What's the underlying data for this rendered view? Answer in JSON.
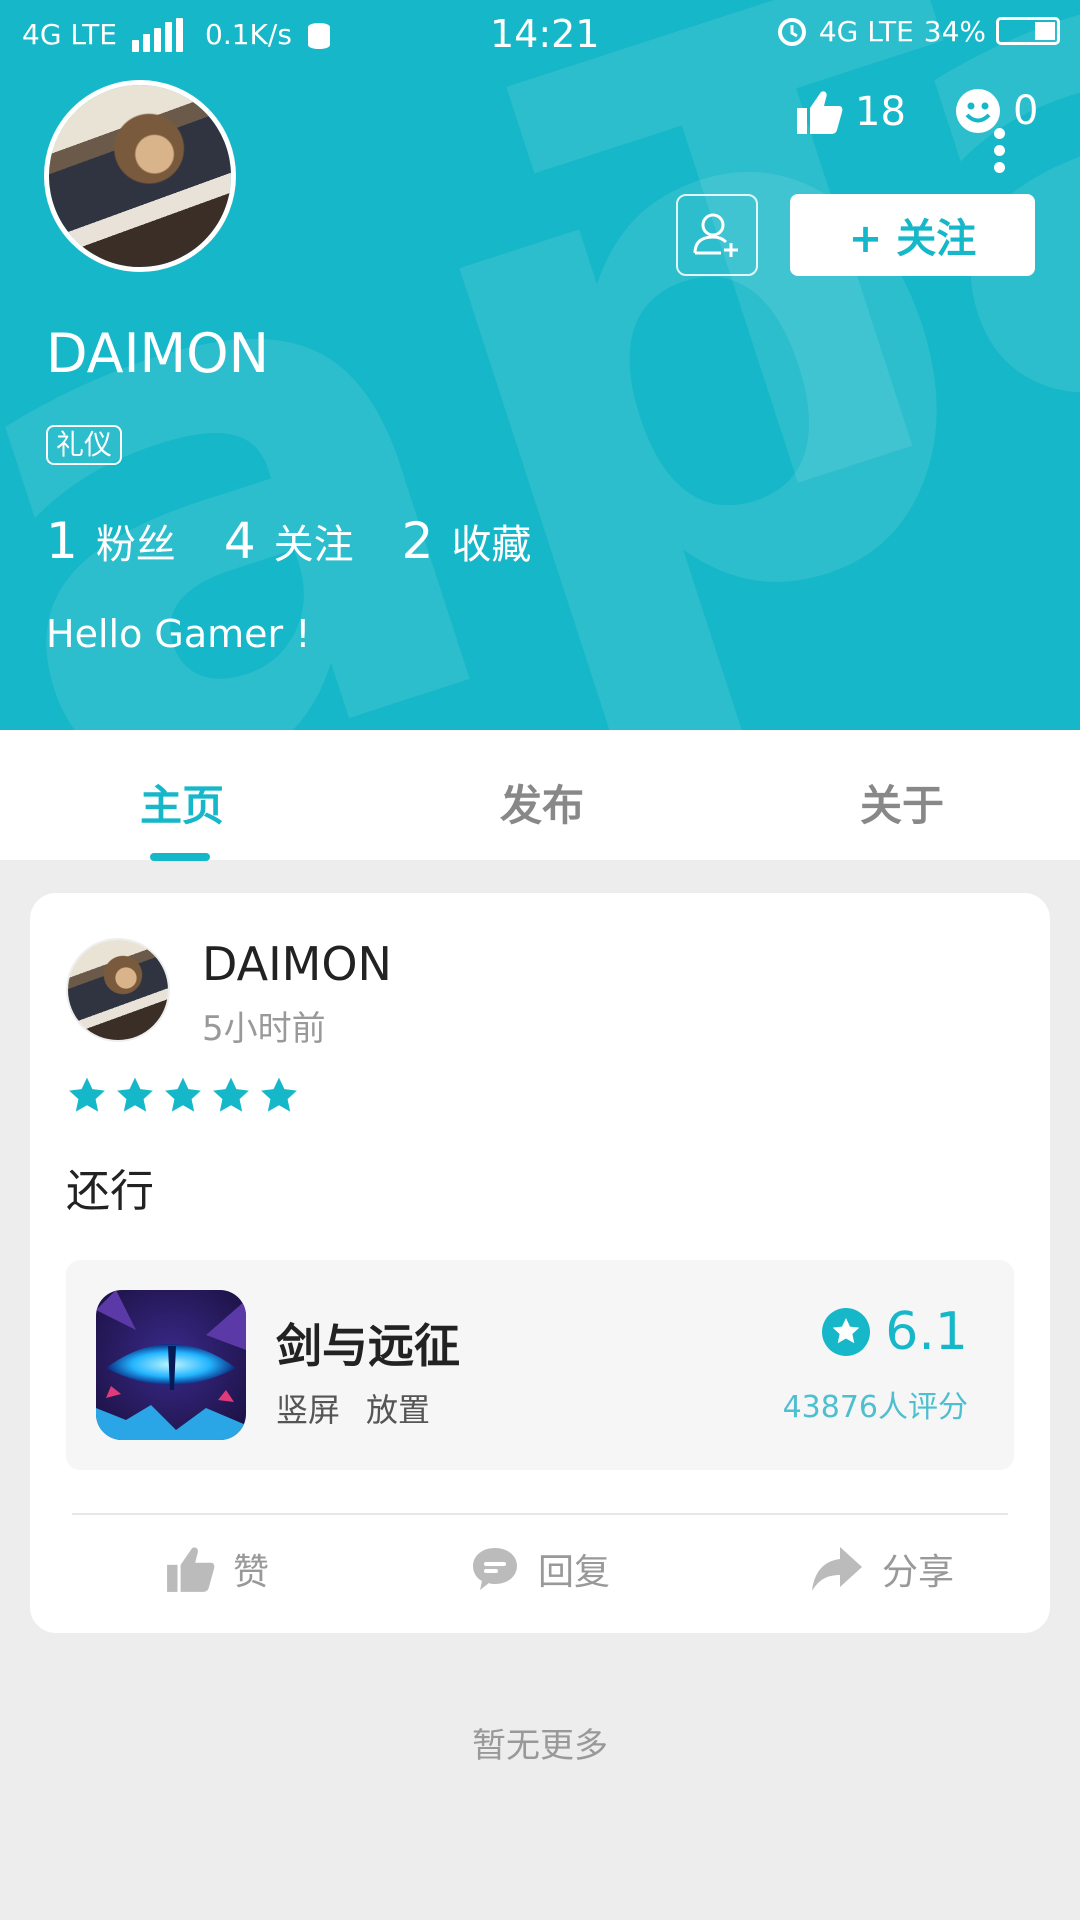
{
  "status_bar": {
    "network_left": "4G LTE",
    "speed": "0.1K/s",
    "time": "14:21",
    "network_right": "4G LTE",
    "battery": "34%"
  },
  "header": {
    "likes_count": "18",
    "emotes_count": "0",
    "follow_button": "+ 关注",
    "username": "DAIMON",
    "tag": "礼仪",
    "stats": [
      {
        "num": "1",
        "label": "粉丝"
      },
      {
        "num": "4",
        "label": "关注"
      },
      {
        "num": "2",
        "label": "收藏"
      }
    ],
    "bio": "Hello Gamer !",
    "accent_color": "#15b7c8"
  },
  "tabs": [
    {
      "label": "主页",
      "active": true
    },
    {
      "label": "发布",
      "active": false
    },
    {
      "label": "关于",
      "active": false
    }
  ],
  "post": {
    "username": "DAIMON",
    "time_ago": "5小时前",
    "stars": 5,
    "text": "还行",
    "game": {
      "name": "剑与远征",
      "tags": [
        "竖屏",
        "放置"
      ],
      "score": "6.1",
      "rating_count": "43876人评分"
    },
    "actions": {
      "like": "赞",
      "reply": "回复",
      "share": "分享"
    }
  },
  "footer_text": "暂无更多"
}
